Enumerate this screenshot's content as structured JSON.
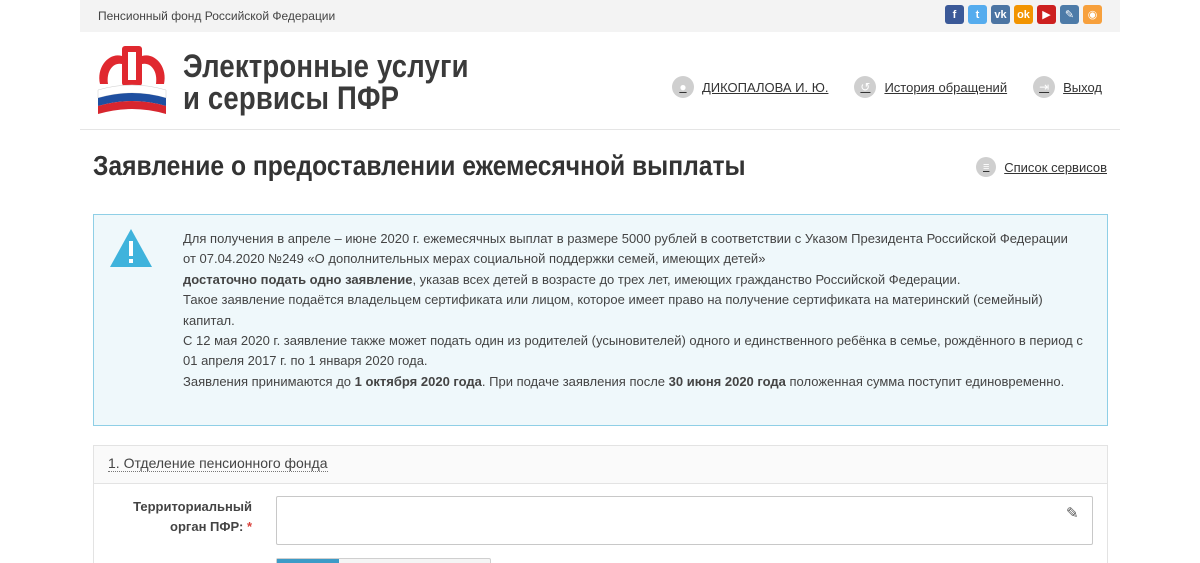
{
  "topbar": {
    "title": "Пенсионный фонд Российской Федерации",
    "social_icons": [
      {
        "name": "facebook-icon",
        "glyph": "f",
        "color": "#3b5998"
      },
      {
        "name": "twitter-icon",
        "glyph": "t",
        "color": "#55acee"
      },
      {
        "name": "vk-icon",
        "glyph": "vk",
        "color": "#4c75a3"
      },
      {
        "name": "odnoklassniki-icon",
        "glyph": "ok",
        "color": "#f29400"
      },
      {
        "name": "youtube-icon",
        "glyph": "▶",
        "color": "#cd201f"
      },
      {
        "name": "livejournal-icon",
        "glyph": "✎",
        "color": "#4d7ba8"
      },
      {
        "name": "rss-icon",
        "glyph": "◉",
        "color": "#f7a03c"
      }
    ]
  },
  "header": {
    "brand_line1": "Электронные услуги",
    "brand_line2": "и сервисы ПФР",
    "user_name": "ДИКОПАЛОВА И. Ю.",
    "history_link": "История обращений",
    "logout_link": "Выход"
  },
  "page": {
    "title": "Заявление о предоставлении ежемесячной выплаты",
    "services_link": "Список сервисов"
  },
  "notice": {
    "p1_a": "Для получения в апреле – июне 2020 г. ежемесячных выплат в размере 5000 рублей в соответствии с Указом Президента Российской Федерации от 07.04.2020 №249 «О дополнительных мерах социальной поддержки семей, имеющих детей»",
    "p1_bold": "достаточно подать одно заявление",
    "p1_b": ", указав всех детей в возрасте до трех лет, имеющих гражданство Российской Федерации.",
    "p2": "Такое заявление подаётся владельцем сертификата или лицом, которое имеет право на получение сертификата на материнский (семейный) капитал.",
    "p3": "С 12 мая 2020 г. заявление также может подать один из родителей (усыновителей) одного и единственного ребёнка в семье, рождённого в период с 01 апреля 2017 г. по 1 января 2020 года.",
    "p4_a": "Заявления принимаются до ",
    "p4_bold1": "1 октября 2020 года",
    "p4_b": ". При подаче заявления после ",
    "p4_bold2": "30 июня 2020 года",
    "p4_c": " положенная сумма поступит единовременно."
  },
  "section1": {
    "title": "1. Отделение пенсионного фонда",
    "field_label": "Территориальный орган ПФР:",
    "required_mark": "*",
    "field_value": ""
  },
  "colors": {
    "notice_border": "#8fcfe6",
    "notice_bg": "#eff8fb",
    "warn_icon": "#3fb3dc",
    "tab_active": "#3d9bc7"
  }
}
